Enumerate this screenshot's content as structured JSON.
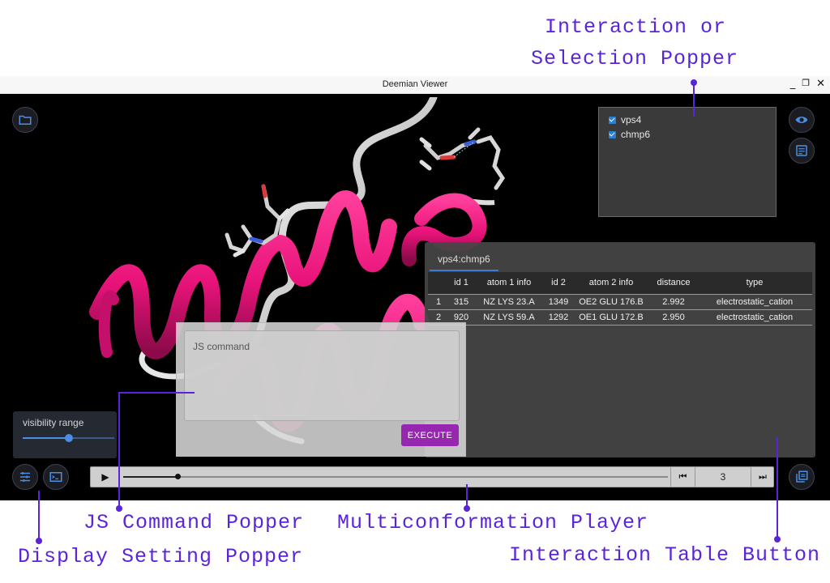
{
  "annotations": {
    "selection_popper_line1": "Interaction or",
    "selection_popper_line2": "Selection Popper",
    "js_command_popper": "JS Command Popper",
    "multiconformation_player": "Multiconformation Player",
    "display_setting_popper": "Display Setting Popper",
    "interaction_table_button": "Interaction Table Button"
  },
  "window": {
    "title": "Deemian Viewer",
    "minimize_glyph": "_",
    "restore_glyph": "❐",
    "close_glyph": "✕"
  },
  "selection": {
    "items": [
      {
        "label": "vps4",
        "checked": true
      },
      {
        "label": "chmp6",
        "checked": true
      }
    ]
  },
  "interaction_table": {
    "tab": "vps4:chmp6",
    "columns": [
      "",
      "id 1",
      "atom 1 info",
      "id 2",
      "atom 2 info",
      "distance",
      "type"
    ],
    "rows": [
      [
        "1",
        "315",
        "NZ LYS 23.A",
        "1349",
        "OE2 GLU 176.B",
        "2.992",
        "electrostatic_cation"
      ],
      [
        "2",
        "920",
        "NZ LYS 59.A",
        "1292",
        "OE1 GLU 172.B",
        "2.950",
        "electrostatic_cation"
      ]
    ]
  },
  "js_command": {
    "placeholder": "JS command",
    "execute_label": "EXECUTE"
  },
  "display_settings": {
    "label": "visibility range",
    "value": 0.5
  },
  "player": {
    "play_glyph": "▶",
    "prev_glyph": "⏮",
    "next_glyph": "⏭",
    "frame": "3",
    "progress": 0.1
  },
  "icons": {
    "folder": "folder-icon",
    "eye": "eye-icon",
    "table": "table-icon",
    "tune": "tune-icon",
    "terminal": "terminal-icon",
    "library": "library-icon"
  },
  "colors": {
    "accent": "#5a24d8",
    "helix": "#e8137a",
    "execute": "#9628b0",
    "tab_underline": "#3e79d6"
  }
}
